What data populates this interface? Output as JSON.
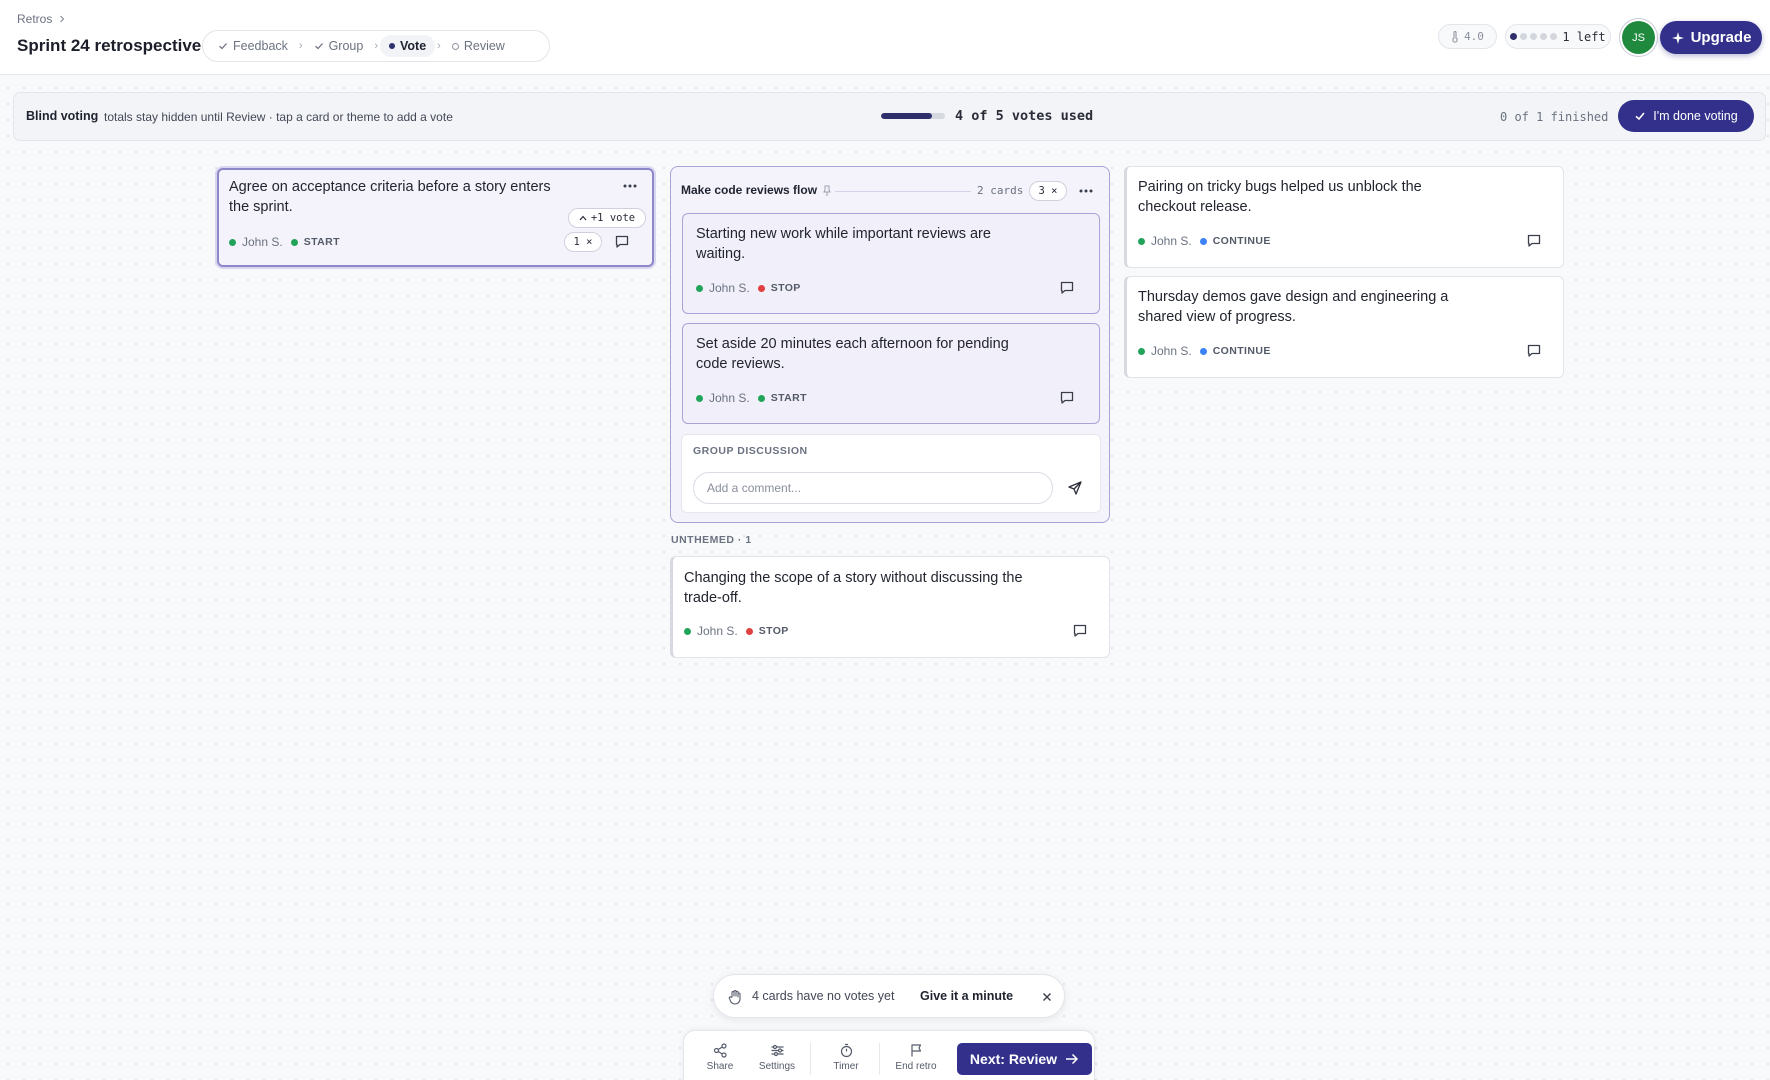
{
  "header": {
    "breadcrumb": "Retros",
    "title": "Sprint 24 retrospective",
    "steps": [
      {
        "label": "Feedback",
        "state": "done"
      },
      {
        "label": "Group",
        "state": "done"
      },
      {
        "label": "Vote",
        "state": "active"
      },
      {
        "label": "Review",
        "state": "pending"
      }
    ],
    "temperature": "4.0",
    "votes_left_label": "1 left",
    "votes_dots": {
      "used": 1,
      "total": 5
    },
    "avatar_initials": "JS",
    "upgrade_label": "Upgrade"
  },
  "banner": {
    "title": "Blind voting",
    "text": "totals stay hidden until Review · tap a card or theme to add a vote",
    "progress_fraction": 0.8,
    "progress_text": "4 of 5 votes used",
    "finished_text": "0 of 1 finished",
    "done_label": "I'm done voting"
  },
  "selected_card": {
    "text": "Agree on acceptance criteria before a story enters the sprint.",
    "author": "John S.",
    "tag": "START",
    "hover_vote_label": "+1 vote",
    "vote_count": "1 ×"
  },
  "theme": {
    "title": "Make code reviews flow",
    "card_count": "2 cards",
    "vote_count": "3 ×",
    "cards": [
      {
        "text": "Starting new work while important reviews are waiting.",
        "author": "John S.",
        "tag": "STOP"
      },
      {
        "text": "Set aside 20 minutes each afternoon for pending code reviews.",
        "author": "John S.",
        "tag": "START"
      }
    ],
    "discussion_label": "GROUP DISCUSSION",
    "comment_placeholder": "Add a comment..."
  },
  "unthemed": {
    "label": "UNTHEMED · 1",
    "card": {
      "text": "Changing the scope of a story without discussing the trade-off.",
      "author": "John S.",
      "tag": "STOP"
    }
  },
  "right_cards": [
    {
      "text": "Pairing on tricky bugs helped us unblock the checkout release.",
      "author": "John S.",
      "tag": "CONTINUE"
    },
    {
      "text": "Thursday demos gave design and engineering a shared view of progress.",
      "author": "John S.",
      "tag": "CONTINUE"
    }
  ],
  "toast": {
    "text": "4 cards have no votes yet",
    "action": "Give it a minute"
  },
  "toolbar": {
    "share": "Share",
    "settings": "Settings",
    "timer": "Timer",
    "end_retro": "End retro",
    "next_label": "Next: Review"
  },
  "colors": {
    "accent": "#32308a",
    "start": "#22a35a",
    "stop": "#e0403f",
    "continue": "#3b82f6"
  }
}
